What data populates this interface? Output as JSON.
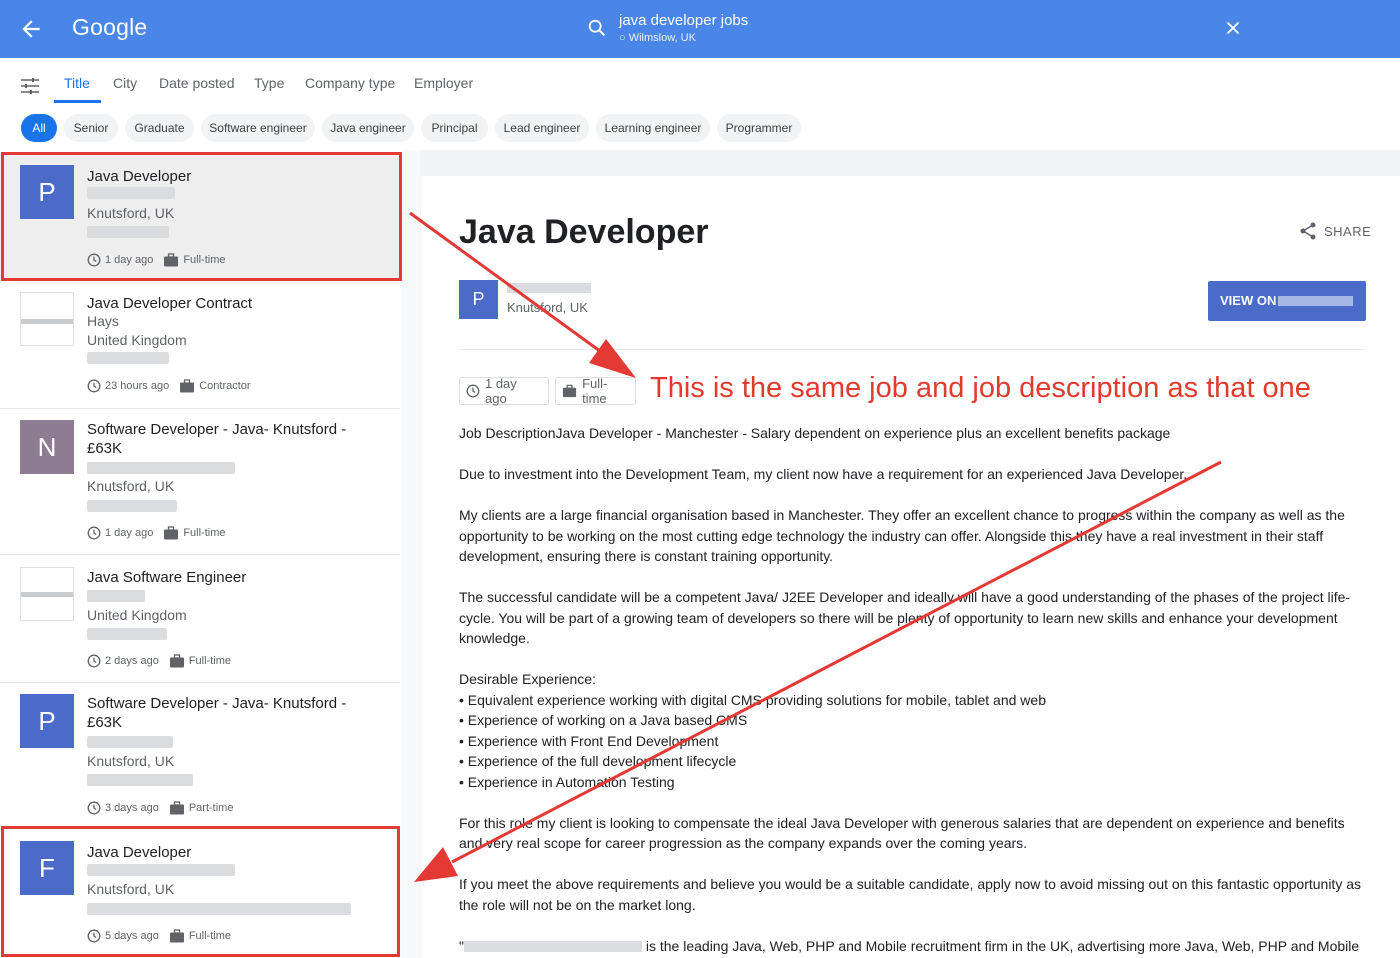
{
  "header": {
    "logo": "Google",
    "query": "java developer jobs",
    "location": "Wilmslow, UK"
  },
  "tabs": [
    "Title",
    "City",
    "Date posted",
    "Type",
    "Company type",
    "Employer"
  ],
  "chips": [
    "All",
    "Senior",
    "Graduate",
    "Software engineer",
    "Java engineer",
    "Principal",
    "Lead engineer",
    "Learning engineer",
    "Programmer"
  ],
  "jobs": [
    {
      "logo_letter": "P",
      "logo_color": "#4a6bc8",
      "title": "Java Developer",
      "company": "",
      "location": "Knutsford, UK",
      "posted": "1 day ago",
      "type": "Full-time"
    },
    {
      "logo_letter": "",
      "logo_color": "",
      "title": "Java Developer Contract",
      "company": "Hays",
      "location": "United Kingdom",
      "posted": "23 hours ago",
      "type": "Contractor"
    },
    {
      "logo_letter": "N",
      "logo_color": "#8e7c93",
      "title": "Software Developer - Java- Knutsford - £63K",
      "company": "",
      "location": "Knutsford, UK",
      "posted": "1 day ago",
      "type": "Full-time"
    },
    {
      "logo_letter": "",
      "logo_color": "",
      "title": "Java Software Engineer",
      "company": "",
      "location": "United Kingdom",
      "posted": "2 days ago",
      "type": "Full-time"
    },
    {
      "logo_letter": "P",
      "logo_color": "#4a6bc8",
      "title": "Software Developer - Java- Knutsford - £63K",
      "company": "",
      "location": "Knutsford, UK",
      "posted": "3 days ago",
      "type": "Part-time"
    },
    {
      "logo_letter": "F",
      "logo_color": "#4a6bc8",
      "title": "Java Developer",
      "company": "",
      "location": "Knutsford, UK",
      "posted": "5 days ago",
      "type": "Full-time"
    }
  ],
  "detail": {
    "title": "Java Developer",
    "share_label": "SHARE",
    "logo_letter": "P",
    "location": "Knutsford, UK",
    "view_label": "VIEW ON",
    "posted": "1 day ago",
    "type": "Full-time",
    "annotation": "This is the same job and job description as that one",
    "paragraphs": [
      "Job DescriptionJava Developer - Manchester - Salary dependent on experience plus an excellent benefits package",
      "Due to investment into the Development Team, my client now have a requirement for an experienced Java Developer.",
      "My clients are a large financial organisation based in Manchester. They offer an excellent chance to progress within the company as well as the opportunity to be working on the most cutting edge technology the industry can offer. Alongside this they have a real investment in their staff development, ensuring there is constant training opportunity.",
      "The successful candidate will be a competent Java/ J2EE Developer and ideally will have a good understanding of the phases of the project life-cycle. You will be part of a growing team of developers so there will be plenty of opportunity to learn new skills and enhance your development knowledge."
    ],
    "desirable_heading": "Desirable Experience:",
    "bullets": [
      "• Equivalent experience working with digital CMS providing solutions for mobile, tablet and web",
      "• Experience of working on a Java based CMS",
      "• Experience with Front End Development",
      "• Experience of the full development lifecycle",
      "• Experience in Automation Testing"
    ],
    "paragraphs_after": [
      "For this role my client is looking to compensate the ideal Java Developer with generous salaries that are dependent on experience and benefits and very real scope for career progression as the company expands over the coming years.",
      "If you meet the above requirements and believe you would be a suitable candidate, apply now to avoid missing out on this fantastic opportunity as the role will not be on the market long."
    ],
    "last_line_prefix": "\"",
    "last_line": " is the leading Java, Web, PHP and Mobile recruitment firm in the UK, advertising more Java, Web, PHP and Mobile"
  },
  "colors": {
    "header": "#4a86e8",
    "accent": "#1a73e8",
    "annotation": "#e33a2e",
    "logo_blue": "#4a6bc8"
  }
}
